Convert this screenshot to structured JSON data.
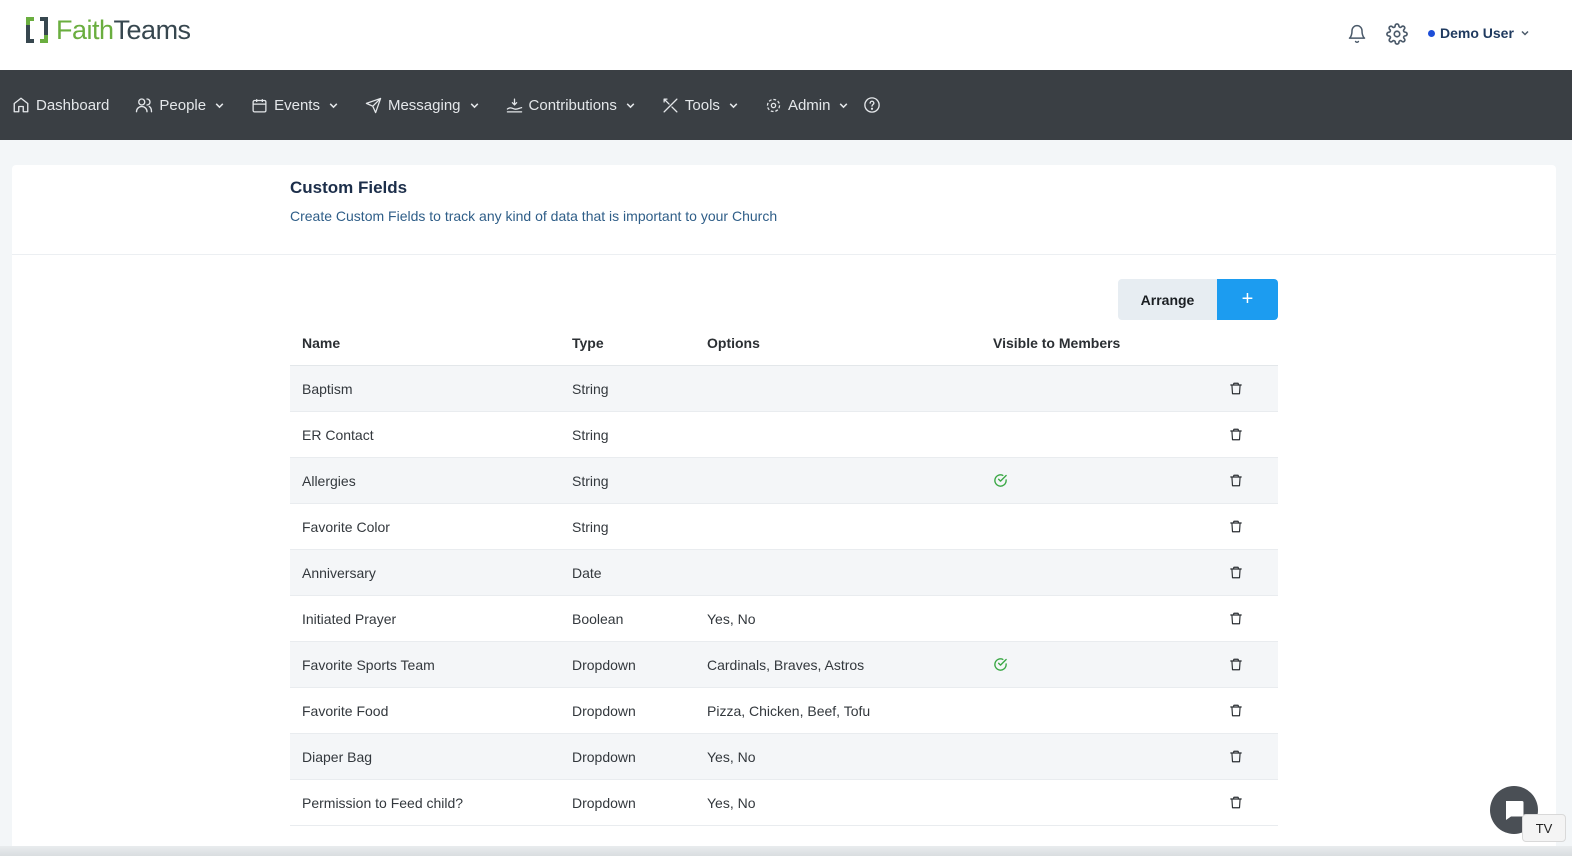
{
  "brand": {
    "part1": "Faith",
    "part2": "Teams",
    "accent_color": "#6aae3f"
  },
  "header": {
    "icons": [
      "bell-icon",
      "gear-icon"
    ],
    "user_name": "Demo User"
  },
  "nav": {
    "items": [
      {
        "label": "Dashboard",
        "icon": "home-icon",
        "has_dropdown": false
      },
      {
        "label": "People",
        "icon": "people-icon",
        "has_dropdown": true
      },
      {
        "label": "Events",
        "icon": "calendar-icon",
        "has_dropdown": true
      },
      {
        "label": "Messaging",
        "icon": "send-icon",
        "has_dropdown": true
      },
      {
        "label": "Contributions",
        "icon": "hand-coin-icon",
        "has_dropdown": true
      },
      {
        "label": "Tools",
        "icon": "tools-icon",
        "has_dropdown": true
      },
      {
        "label": "Admin",
        "icon": "gear-icon",
        "has_dropdown": true
      }
    ],
    "help_icon": "help-circle-icon"
  },
  "page": {
    "title": "Custom Fields",
    "subtitle": "Create Custom Fields to track any kind of data that is important to your Church"
  },
  "toolbar": {
    "arrange_label": "Arrange",
    "add_label": "+"
  },
  "table": {
    "columns": [
      "Name",
      "Type",
      "Options",
      "Visible to Members"
    ],
    "rows": [
      {
        "name": "Baptism",
        "type": "String",
        "options": "",
        "visible": false
      },
      {
        "name": "ER Contact",
        "type": "String",
        "options": "",
        "visible": false
      },
      {
        "name": "Allergies",
        "type": "String",
        "options": "",
        "visible": true
      },
      {
        "name": "Favorite Color",
        "type": "String",
        "options": "",
        "visible": false
      },
      {
        "name": "Anniversary",
        "type": "Date",
        "options": "",
        "visible": false
      },
      {
        "name": "Initiated Prayer",
        "type": "Boolean",
        "options": "Yes, No",
        "visible": false
      },
      {
        "name": "Favorite Sports Team",
        "type": "Dropdown",
        "options": "Cardinals, Braves, Astros",
        "visible": true
      },
      {
        "name": "Favorite Food",
        "type": "Dropdown",
        "options": "Pizza, Chicken, Beef, Tofu",
        "visible": false
      },
      {
        "name": "Diaper Bag",
        "type": "Dropdown",
        "options": "Yes, No",
        "visible": false
      },
      {
        "name": "Permission to Feed child?",
        "type": "Dropdown",
        "options": "Yes, No",
        "visible": false
      }
    ]
  },
  "widgets": {
    "badge_text": "TV",
    "chat_icon": "chat-icon"
  },
  "colors": {
    "nav_bg": "#3a3f44",
    "primary": "#1c9cf0",
    "check": "#3aa845"
  }
}
